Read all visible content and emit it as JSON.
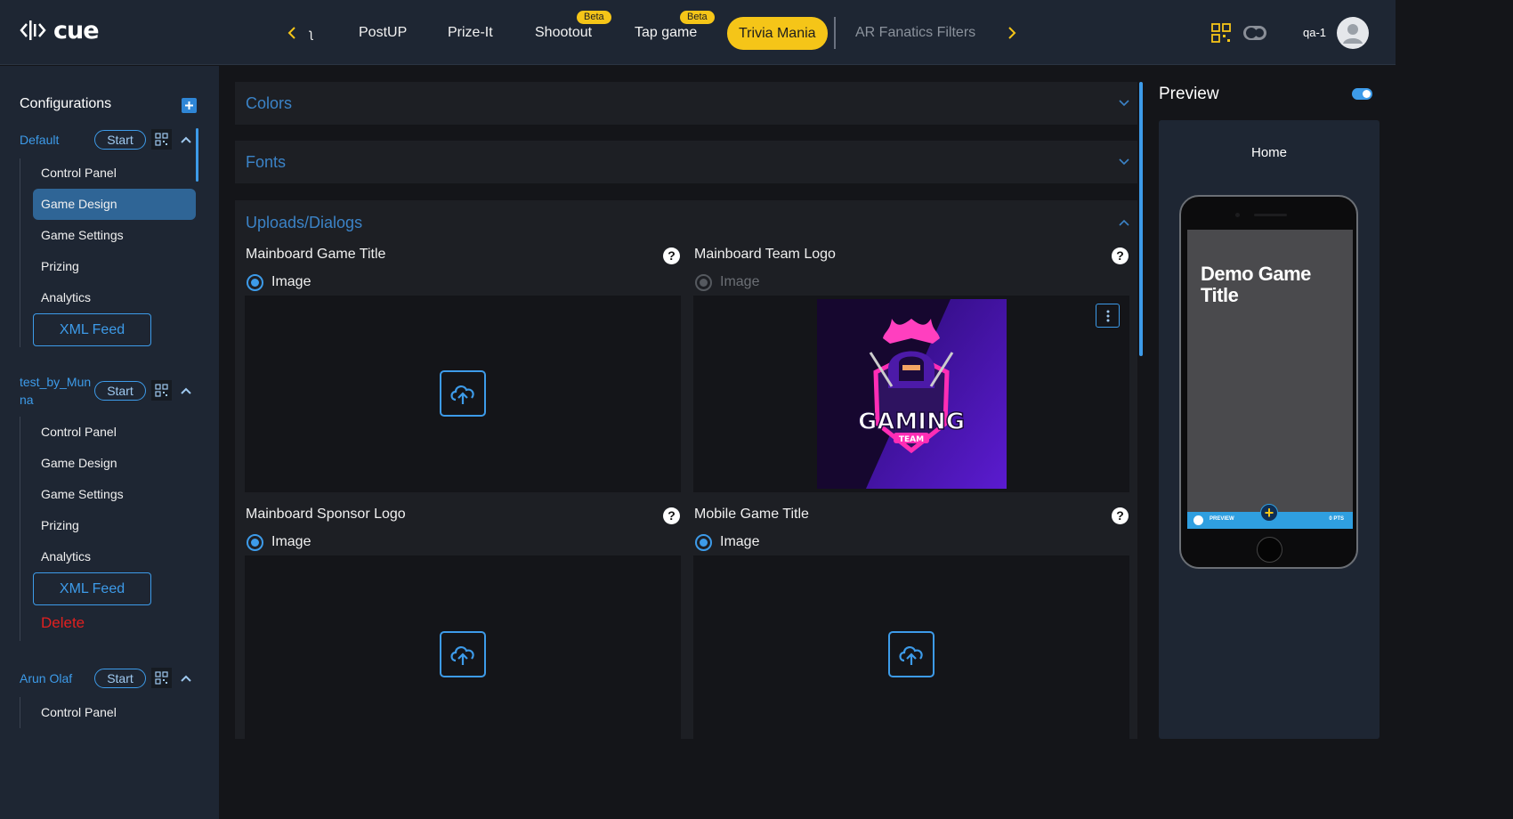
{
  "app": {
    "logo_text": "cue",
    "user": "qa-1"
  },
  "nav": {
    "tabs": [
      {
        "label": "PostUP"
      },
      {
        "label": "Prize-It"
      },
      {
        "label": "Shootout",
        "badge": "Beta"
      },
      {
        "label": "Tap game",
        "badge": "Beta"
      },
      {
        "label": "Trivia Mania",
        "active": true
      },
      {
        "label": "AR Fanatics Filters",
        "disabled": true
      }
    ],
    "partial_tab": "ʅ"
  },
  "sidebar": {
    "title": "Configurations",
    "configs": [
      {
        "name": "Default",
        "start_label": "Start",
        "items": [
          "Control Panel",
          "Game Design",
          "Game Settings",
          "Prizing",
          "Analytics"
        ],
        "active_item": "Game Design",
        "xml_label": "XML Feed"
      },
      {
        "name_line1": "test_by_Mun",
        "name_line2": "na",
        "start_label": "Start",
        "items": [
          "Control Panel",
          "Game Design",
          "Game Settings",
          "Prizing",
          "Analytics"
        ],
        "xml_label": "XML Feed",
        "delete_label": "Delete"
      },
      {
        "name": "Arun Olaf",
        "start_label": "Start",
        "items": [
          "Control Panel"
        ]
      }
    ]
  },
  "main": {
    "sections": {
      "colors": "Colors",
      "fonts": "Fonts",
      "uploads": "Uploads/Dialogs"
    },
    "fields": [
      {
        "label": "Mainboard Game Title",
        "radio": "Image"
      },
      {
        "label": "Mainboard Team Logo",
        "radio": "Image",
        "logo_text": "GAMING",
        "logo_sub": "TEAM"
      },
      {
        "label": "Mainboard Sponsor Logo",
        "radio": "Image"
      },
      {
        "label": "Mobile Game Title",
        "radio": "Image"
      }
    ],
    "help_glyph": "?"
  },
  "preview": {
    "title": "Preview",
    "screen_label": "Home",
    "phone_title": "Demo Game Title",
    "phone_bar_left": "PREVIEW",
    "phone_bar_right": "0 PTS",
    "phone_plus": "+"
  },
  "colors": {
    "accent": "#3d9be9",
    "active_tab": "#f5c518",
    "delete": "#e02020",
    "panel": "#1d1f24",
    "topbar": "#1e2633"
  },
  "icons": [
    "logo-icon",
    "chevron-left-icon",
    "chevron-right-icon",
    "qr-code-icon",
    "theme-toggle-icon",
    "user-avatar-icon",
    "plus-icon",
    "chevron-up-icon",
    "chevron-down-icon",
    "help-icon",
    "upload-icon",
    "kebab-menu-icon"
  ]
}
